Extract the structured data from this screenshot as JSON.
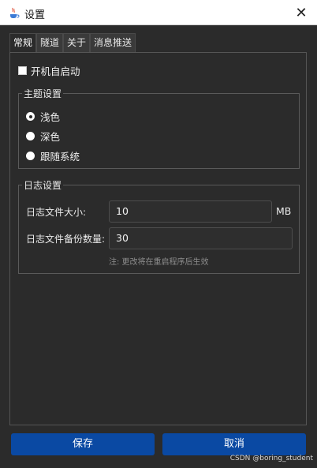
{
  "window": {
    "title": "设置",
    "close_glyph": "✕",
    "icon": "java-cup-icon"
  },
  "tabs": [
    {
      "label": "常规",
      "active": true
    },
    {
      "label": "隧道",
      "active": false
    },
    {
      "label": "关于",
      "active": false
    },
    {
      "label": "消息推送",
      "active": false
    }
  ],
  "general": {
    "autostart": {
      "label": "开机自启动",
      "checked": false
    },
    "theme": {
      "title": "主题设置",
      "options": [
        {
          "label": "浅色",
          "checked": true
        },
        {
          "label": "深色",
          "checked": false
        },
        {
          "label": "跟随系统",
          "checked": false
        }
      ]
    },
    "log": {
      "title": "日志设置",
      "size_label": "日志文件大小:",
      "size_value": "10",
      "size_unit": "MB",
      "backup_label": "日志文件备份数量:",
      "backup_value": "30",
      "note": "注: 更改将在重启程序后生效"
    }
  },
  "actions": {
    "save_label": "保存",
    "cancel_label": "取消"
  },
  "watermark": "CSDN @boring_student",
  "colors": {
    "background": "#2b2b2b",
    "primary_button": "#0a49a3",
    "titlebar": "#ffffff"
  }
}
